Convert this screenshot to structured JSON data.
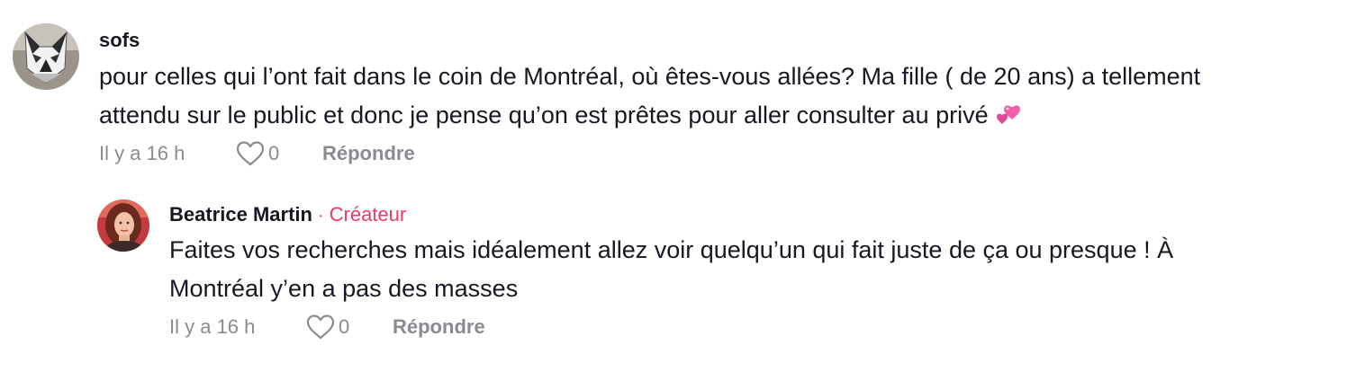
{
  "comments": [
    {
      "username": "sofs",
      "text_line1": "pour celles qui l’ont fait dans le coin de Montréal, où êtes-vous allées? Ma fille ( de 20 ans) a tellement",
      "text_line2": "attendu sur le public et donc je pense qu’on est prêtes pour aller consulter au privé",
      "emoji": "two-hearts-emoji",
      "time": "Il y a 16 h",
      "likes": "0",
      "reply_label": "Répondre",
      "avatar_icon": "wolf-mask-avatar"
    },
    {
      "username": "Beatrice Martin",
      "separator": "·",
      "badge": "Créateur",
      "text_line1": "Faites vos recherches mais idéalement allez voir quelqu’un qui fait juste de ça ou presque ! À",
      "text_line2": "Montréal y’en a pas des masses",
      "time": "Il y a 16 h",
      "likes": "0",
      "reply_label": "Répondre",
      "avatar_icon": "woman-portrait-avatar"
    }
  ],
  "colors": {
    "text": "#161823",
    "meta": "#8a8b91",
    "creator": "#ec3a67"
  }
}
